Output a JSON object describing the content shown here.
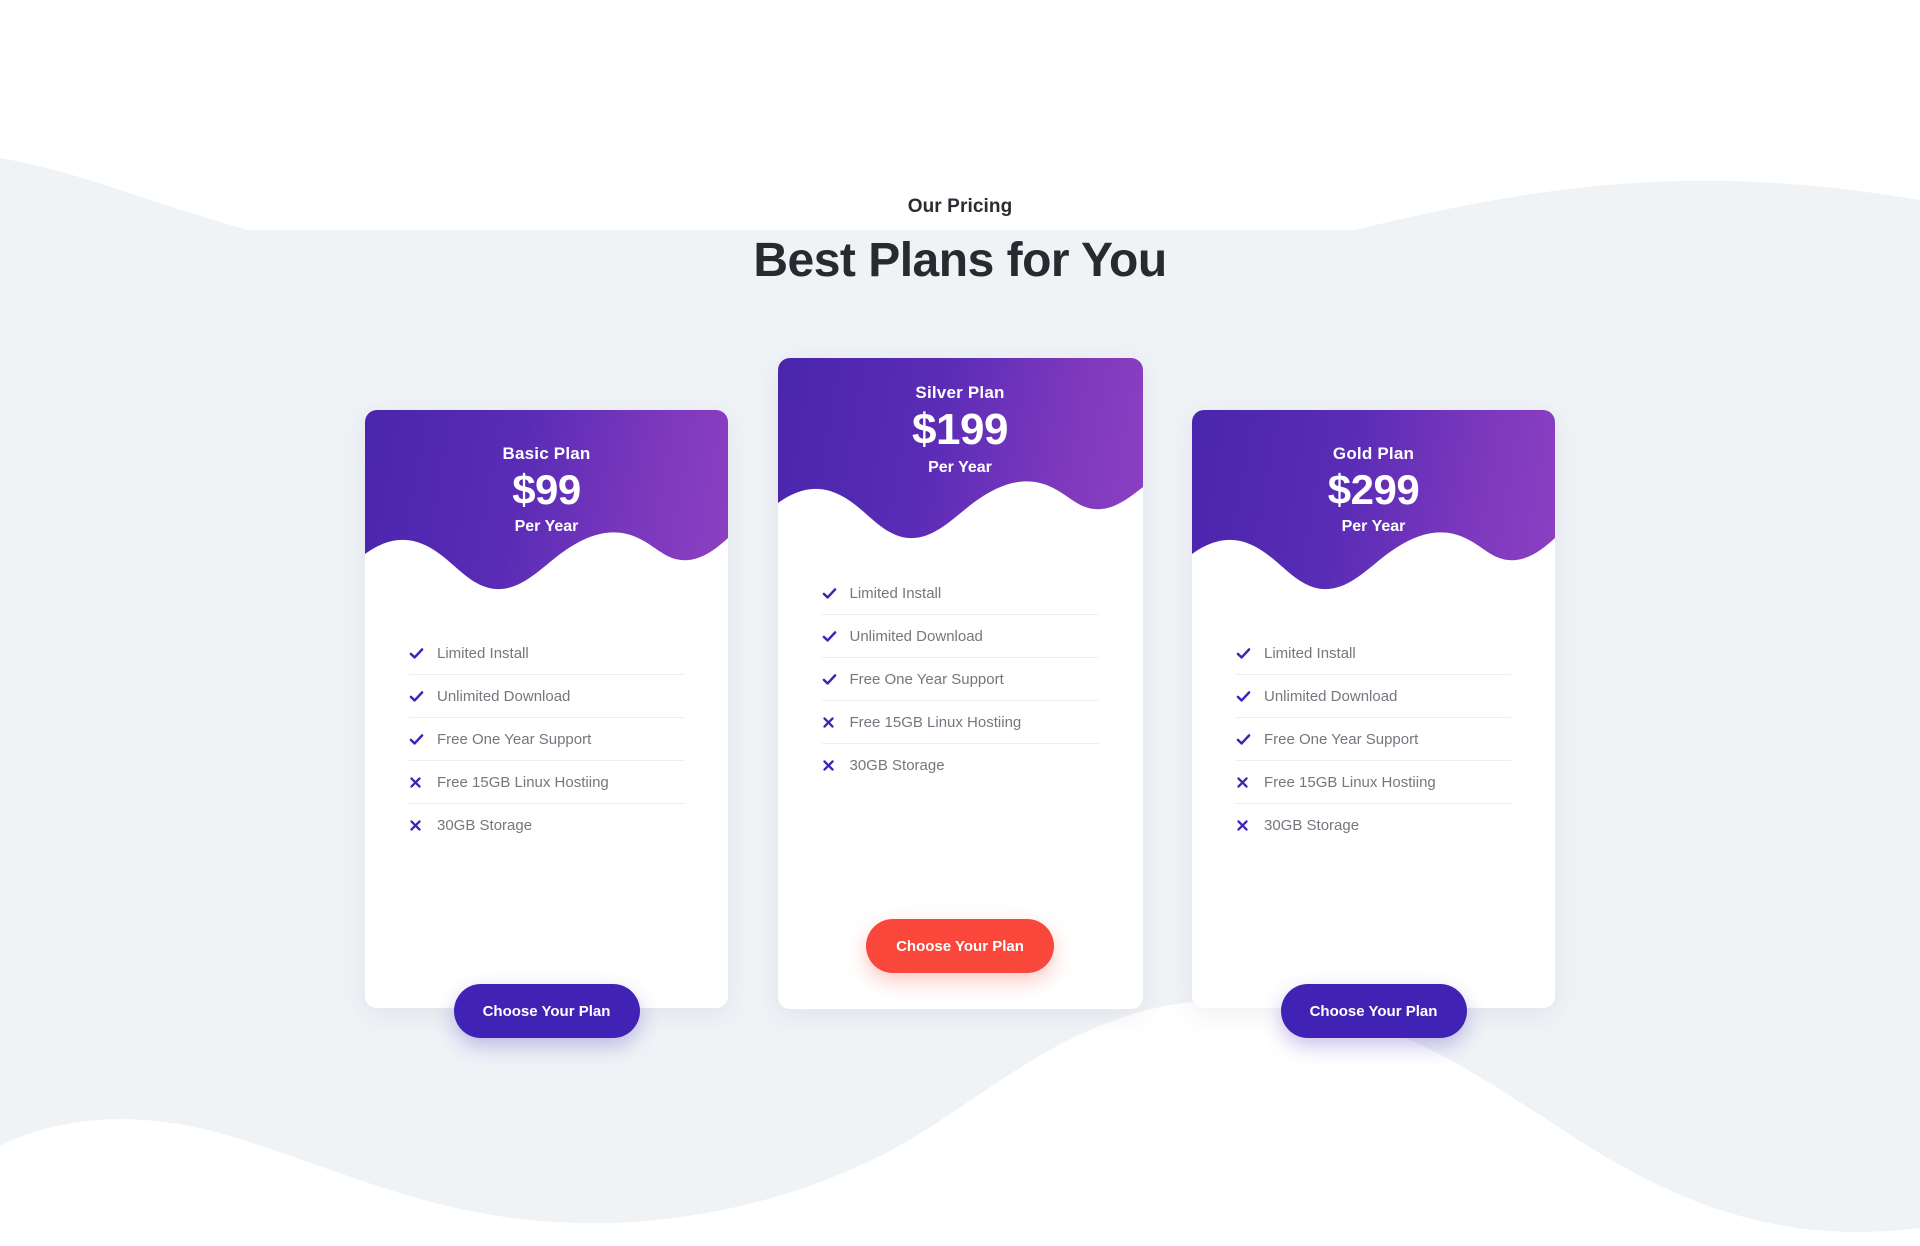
{
  "colors": {
    "page_background": "#eff3f6",
    "wave_white": "#ffffff",
    "card_gradient_start": "#4a25ad",
    "card_gradient_end": "#8d40c2",
    "accent_purple": "#4023b5",
    "accent_red": "#f9483b",
    "title_color": "#292930",
    "feature_text": "#76767f"
  },
  "header": {
    "eyebrow": "Our Pricing",
    "title": "Best Plans for You"
  },
  "plans": [
    {
      "name": "Basic Plan",
      "price": "$99",
      "period": "Per Year",
      "cta_label": "Choose Your Plan",
      "features": [
        {
          "label": "Limited Install",
          "icon": "check-icon",
          "included": true
        },
        {
          "label": "Unlimited Download",
          "icon": "check-icon",
          "included": true
        },
        {
          "label": "Free One Year Support",
          "icon": "check-icon",
          "included": true
        },
        {
          "label": "Free 15GB Linux Hostiing",
          "icon": "cross-icon",
          "included": false
        },
        {
          "label": "30GB Storage",
          "icon": "cross-icon",
          "included": false
        }
      ]
    },
    {
      "name": "Silver Plan",
      "price": "$199",
      "period": "Per Year",
      "cta_label": "Choose Your Plan",
      "featured": true,
      "features": [
        {
          "label": "Limited Install",
          "icon": "check-icon",
          "included": true
        },
        {
          "label": "Unlimited Download",
          "icon": "check-icon",
          "included": true
        },
        {
          "label": "Free One Year Support",
          "icon": "check-icon",
          "included": true
        },
        {
          "label": "Free 15GB Linux Hostiing",
          "icon": "cross-icon",
          "included": false
        },
        {
          "label": "30GB Storage",
          "icon": "cross-icon",
          "included": false
        }
      ]
    },
    {
      "name": "Gold Plan",
      "price": "$299",
      "period": "Per Year",
      "cta_label": "Choose Your Plan",
      "features": [
        {
          "label": "Limited Install",
          "icon": "check-icon",
          "included": true
        },
        {
          "label": "Unlimited Download",
          "icon": "check-icon",
          "included": true
        },
        {
          "label": "Free One Year Support",
          "icon": "check-icon",
          "included": true
        },
        {
          "label": "Free 15GB Linux Hostiing",
          "icon": "cross-icon",
          "included": false
        },
        {
          "label": "30GB Storage",
          "icon": "cross-icon",
          "included": false
        }
      ]
    }
  ]
}
